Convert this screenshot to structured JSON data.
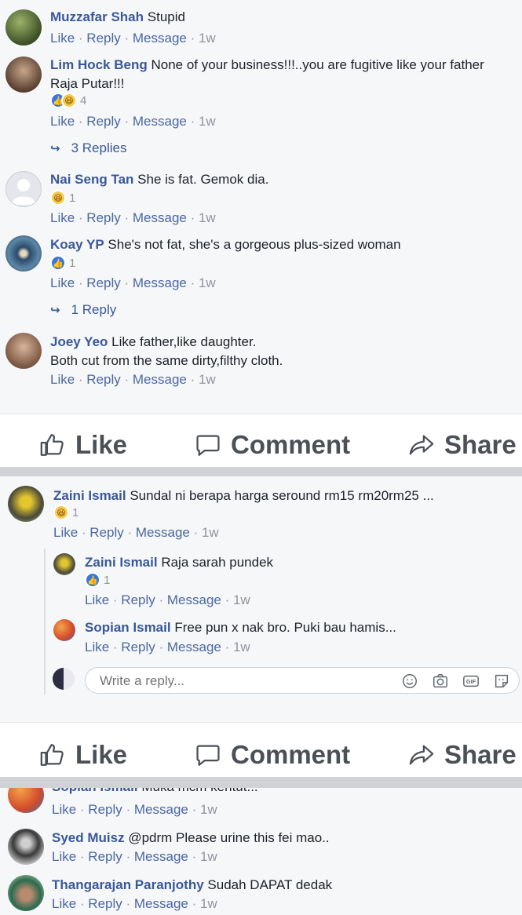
{
  "section1": {
    "comments": [
      {
        "name": "Muzzafar Shah",
        "text": "Stupid",
        "like": "Like",
        "reply": "Reply",
        "message": "Message",
        "time": "1w"
      },
      {
        "name": "Lim Hock Beng",
        "text": "None of your business!!!..you are fugitive like your father",
        "text2": "Raja Putar!!!",
        "reaction_count": "4",
        "like": "Like",
        "reply": "Reply",
        "message": "Message",
        "time": "1w",
        "replies": "3 Replies"
      },
      {
        "name": "Nai Seng Tan",
        "text": "She is fat. Gemok dia.",
        "reaction_count": "1",
        "like": "Like",
        "reply": "Reply",
        "message": "Message",
        "time": "1w"
      },
      {
        "name": "Koay YP",
        "text": "She's not fat, she's a gorgeous plus-sized woman",
        "reaction_count": "1",
        "like": "Like",
        "reply": "Reply",
        "message": "Message",
        "time": "1w",
        "replies": "1 Reply"
      },
      {
        "name": "Joey Yeo",
        "text": "Like father,like daughter.",
        "text2": "Both cut from the same dirty,filthy cloth.",
        "like": "Like",
        "reply": "Reply",
        "message": "Message",
        "time": "1w"
      }
    ]
  },
  "actions": {
    "like": "Like",
    "comment": "Comment",
    "share": "Share"
  },
  "section2": {
    "main": {
      "name": "Zaini Ismail",
      "text": "Sundal ni berapa harga seround rm15 rm20rm25 ...",
      "reaction_count": "1",
      "like": "Like",
      "reply": "Reply",
      "message": "Message",
      "time": "1w"
    },
    "replies": [
      {
        "name": "Zaini Ismail",
        "text": "Raja sarah pundek",
        "reaction_count": "1",
        "like": "Like",
        "reply": "Reply",
        "message": "Message",
        "time": "1w"
      },
      {
        "name": "Sopian Ismail",
        "text": "Free pun x nak bro. Puki bau hamis...",
        "like": "Like",
        "reply": "Reply",
        "message": "Message",
        "time": "1w"
      }
    ],
    "reply_placeholder": "Write a reply..."
  },
  "section3": {
    "partial": {
      "name": "Sopian Ismail",
      "text": "Muka mcm kentut...",
      "like": "Like",
      "reply": "Reply",
      "message": "Message",
      "time": "1w"
    },
    "comments": [
      {
        "name": "Syed Muisz",
        "text": "@pdrm Please urine this fei mao..",
        "like": "Like",
        "reply": "Reply",
        "message": "Message",
        "time": "1w"
      },
      {
        "name": "Thangarajan Paranjothy",
        "text": "Sudah DAPAT dedak",
        "like": "Like",
        "reply": "Reply",
        "message": "Message",
        "time": "1w"
      }
    ]
  }
}
